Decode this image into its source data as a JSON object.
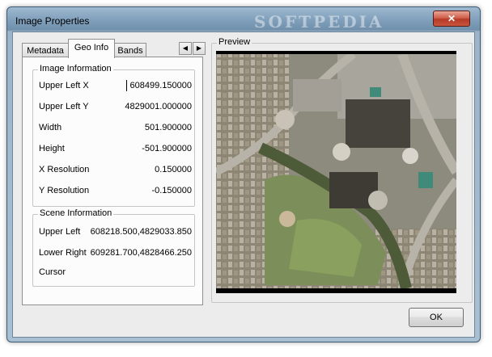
{
  "window": {
    "title": "Image Properties",
    "watermark": "SOFTPEDIA",
    "close_symbol": "✕"
  },
  "tabs": [
    {
      "label": "Metadata",
      "active": false
    },
    {
      "label": "Geo Info",
      "active": true
    },
    {
      "label": "Bands",
      "active": false
    }
  ],
  "tab_scroll": {
    "left": "◀",
    "right": "▶"
  },
  "image_information": {
    "title": "Image Information",
    "rows": [
      {
        "label": "Upper Left X",
        "value": "608499.150000"
      },
      {
        "label": "Upper Left Y",
        "value": "4829001.000000"
      },
      {
        "label": "Width",
        "value": "501.900000"
      },
      {
        "label": "Height",
        "value": "-501.900000"
      },
      {
        "label": "X Resolution",
        "value": "0.150000"
      },
      {
        "label": "Y Resolution",
        "value": "-0.150000"
      }
    ]
  },
  "scene_information": {
    "title": "Scene Information",
    "rows": [
      {
        "label": "Upper Left",
        "value": "608218.500,4829033.850"
      },
      {
        "label": "Lower Right",
        "value": "609281.700,4828466.250"
      },
      {
        "label": "Cursor",
        "value": ""
      }
    ]
  },
  "preview": {
    "title": "Preview",
    "image_name": "aerial-photo"
  },
  "ok_button": "OK",
  "colors": {
    "grass": "#7c8f5a",
    "roads": "#b8b3a8",
    "pool": "#3f8a78"
  }
}
